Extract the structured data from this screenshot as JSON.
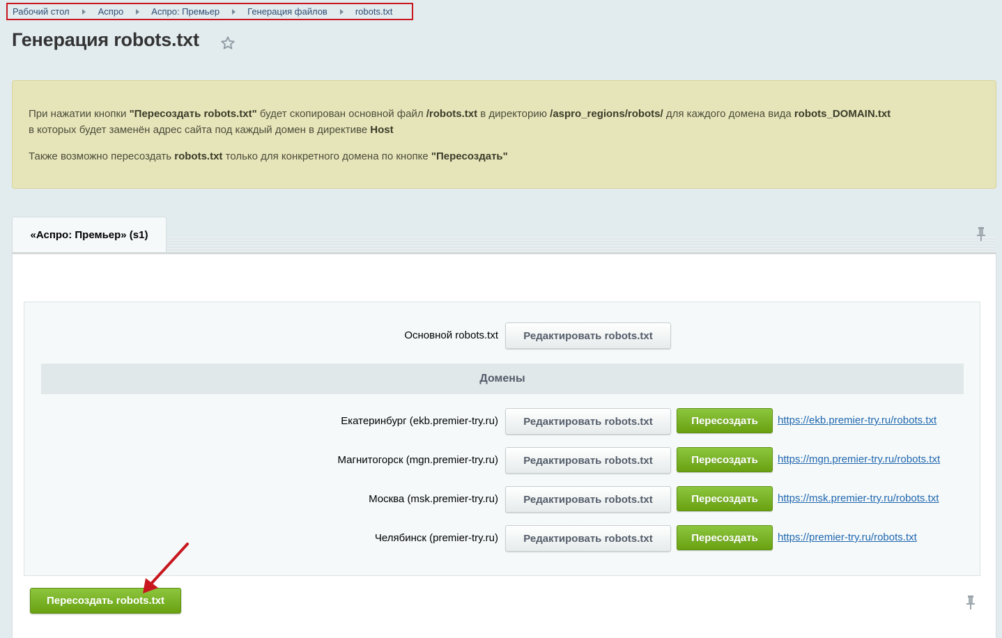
{
  "breadcrumb": [
    "Рабочий стол",
    "Аспро",
    "Аспро: Премьер",
    "Генерация файлов",
    "robots.txt"
  ],
  "page_title": "Генерация robots.txt",
  "note": {
    "line1": [
      {
        "t": "При нажатии кнопки ",
        "b": false
      },
      {
        "t": "\"Пересоздать robots.txt\"",
        "b": true
      },
      {
        "t": " будет скопирован основной файл ",
        "b": false
      },
      {
        "t": "/robots.txt",
        "b": true
      },
      {
        "t": " в директорию ",
        "b": false
      },
      {
        "t": "/aspro_regions/robots/",
        "b": true
      },
      {
        "t": " для каждого домена вида ",
        "b": false
      },
      {
        "t": "robots_DOMAIN.txt",
        "b": true
      }
    ],
    "line2": [
      {
        "t": "в которых будет заменён адрес сайта под каждый домен в директиве ",
        "b": false
      },
      {
        "t": "Host",
        "b": true
      }
    ],
    "line3": [
      {
        "t": "Также возможно пересоздать ",
        "b": false
      },
      {
        "t": "robots.txt",
        "b": true
      },
      {
        "t": " только для конкретного домена по кнопке ",
        "b": false
      },
      {
        "t": "\"Пересоздать\"",
        "b": true
      }
    ]
  },
  "tab": {
    "label": "«Аспро: Премьер» (s1)"
  },
  "main_robots": {
    "label": "Основной robots.txt",
    "edit_label": "Редактировать robots.txt"
  },
  "domains_header": "Домены",
  "domains": [
    {
      "label": "Екатеринбург (ekb.premier-try.ru)",
      "edit_label": "Редактировать robots.txt",
      "recreate_label": "Пересоздать",
      "link": "https://ekb.premier-try.ru/robots.txt"
    },
    {
      "label": "Магнитогорск (mgn.premier-try.ru)",
      "edit_label": "Редактировать robots.txt",
      "recreate_label": "Пересоздать",
      "link": "https://mgn.premier-try.ru/robots.txt"
    },
    {
      "label": "Москва (msk.premier-try.ru)",
      "edit_label": "Редактировать robots.txt",
      "recreate_label": "Пересоздать",
      "link": "https://msk.premier-try.ru/robots.txt"
    },
    {
      "label": "Челябинск (premier-try.ru)",
      "edit_label": "Редактировать robots.txt",
      "recreate_label": "Пересоздать",
      "link": "https://premier-try.ru/robots.txt"
    }
  ],
  "footer": {
    "recreate_all_label": "Пересоздать robots.txt"
  },
  "colors": {
    "accent_green": "#7ab52a",
    "link_blue": "#2067b0",
    "highlight_red": "#c8171f",
    "note_bg": "#e6e5b9"
  }
}
